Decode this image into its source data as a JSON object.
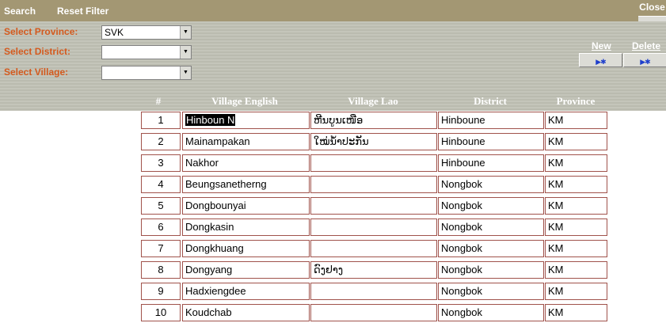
{
  "toolbar": {
    "search_label": "Search",
    "reset_filter_label": "Reset Filter",
    "close_label": "Close"
  },
  "filters": {
    "province": {
      "label": "Select Province:",
      "value": "SVK"
    },
    "district": {
      "label": "Select District:",
      "value": ""
    },
    "village": {
      "label": "Select Village:",
      "value": ""
    }
  },
  "actions": {
    "new_label": "New",
    "delete_label": "Delete"
  },
  "table": {
    "headers": [
      "#",
      "Village English",
      "Village Lao",
      "District",
      "Province"
    ],
    "rows": [
      {
        "num": "1",
        "english": "Hinboun  N",
        "lao": "ຫີນບູນເໜືອ",
        "district": "Hinboune",
        "province": "KM"
      },
      {
        "num": "2",
        "english": "Mainampakan",
        "lao": "ໃໝ່ນ້ຳປະກັນ",
        "district": "Hinboune",
        "province": "KM"
      },
      {
        "num": "3",
        "english": "Nakhor",
        "lao": "",
        "district": "Hinboune",
        "province": "KM"
      },
      {
        "num": "4",
        "english": "Beungsanetherng",
        "lao": "",
        "district": "Nongbok",
        "province": "KM"
      },
      {
        "num": "5",
        "english": "Dongbounyai",
        "lao": "",
        "district": "Nongbok",
        "province": "KM"
      },
      {
        "num": "6",
        "english": "Dongkasin",
        "lao": "",
        "district": "Nongbok",
        "province": "KM"
      },
      {
        "num": "7",
        "english": "Dongkhuang",
        "lao": "",
        "district": "Nongbok",
        "province": "KM"
      },
      {
        "num": "8",
        "english": "Dongyang",
        "lao": "ດົງຢາງ",
        "district": "Nongbok",
        "province": "KM"
      },
      {
        "num": "9",
        "english": "Hadxiengdee",
        "lao": "",
        "district": "Nongbok",
        "province": "KM"
      },
      {
        "num": "10",
        "english": "Koudchab",
        "lao": "",
        "district": "Nongbok",
        "province": "KM"
      }
    ]
  },
  "colors": {
    "toolbar_bg": "#a39773",
    "label_orange": "#d45a1e",
    "cell_border": "#a0524b",
    "button_arrow": "#1e3ecc"
  }
}
